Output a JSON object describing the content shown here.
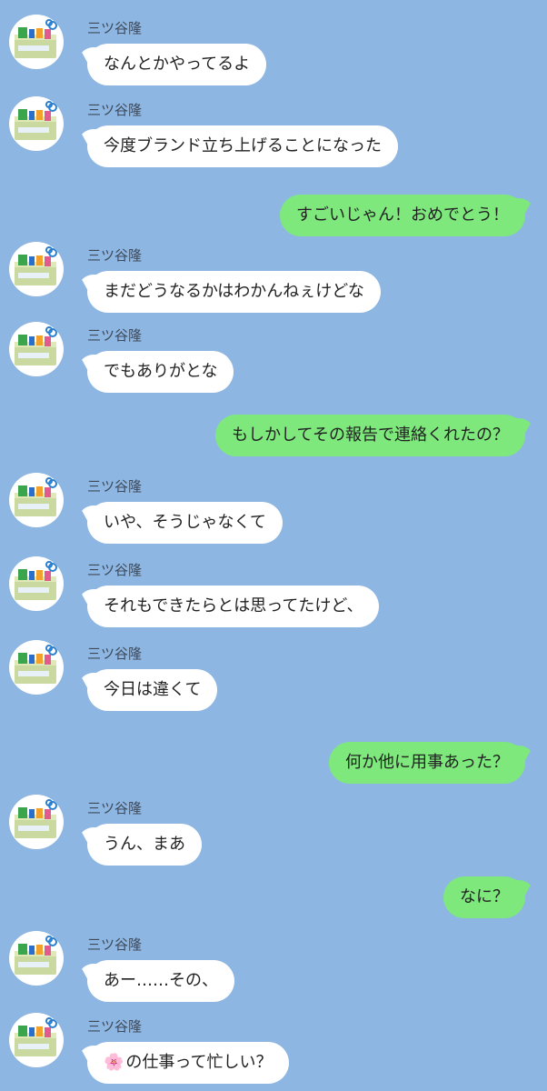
{
  "sender_name": "三ツ谷隆",
  "colors": {
    "background": "#8db6e3",
    "incoming_bubble": "#ffffff",
    "outgoing_bubble": "#7ee87d"
  },
  "messages": [
    {
      "from": "them",
      "text": "なんとかやってるよ"
    },
    {
      "from": "them",
      "text": "今度ブランド立ち上げることになった"
    },
    {
      "from": "me",
      "text": "すごいじゃん！おめでとう！"
    },
    {
      "from": "them",
      "text": "まだどうなるかはわかんねぇけどな"
    },
    {
      "from": "them",
      "text": "でもありがとな"
    },
    {
      "from": "me",
      "text": "もしかしてその報告で連絡くれたの？"
    },
    {
      "from": "them",
      "text": "いや、そうじゃなくて"
    },
    {
      "from": "them",
      "text": "それもできたらとは思ってたけど、"
    },
    {
      "from": "them",
      "text": "今日は違くて"
    },
    {
      "from": "me",
      "text": "何か他に用事あった？"
    },
    {
      "from": "them",
      "text": "うん、まあ"
    },
    {
      "from": "me",
      "text": "なに？"
    },
    {
      "from": "them",
      "text": "あー……その、"
    },
    {
      "from": "them",
      "icon": "cherry-blossom-emoji",
      "text": "の仕事って忙しい？"
    }
  ]
}
